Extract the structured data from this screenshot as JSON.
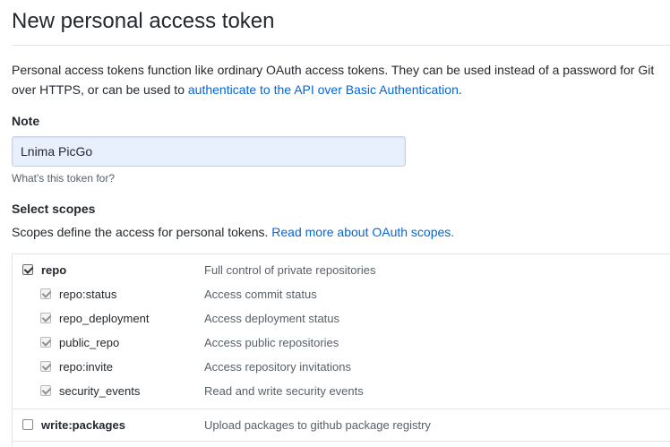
{
  "page": {
    "title": "New personal access token",
    "intro_text": "Personal access tokens function like ordinary OAuth access tokens. They can be used instead of a password for Git over HTTPS, or can be used to ",
    "intro_link": "authenticate to the API over Basic Authentication",
    "intro_end": "."
  },
  "note": {
    "label": "Note",
    "value": "Lnima PicGo",
    "hint": "What's this token for?"
  },
  "scopes": {
    "label": "Select scopes",
    "desc": "Scopes define the access for personal tokens. ",
    "link": "Read more about OAuth scopes.",
    "groups": [
      {
        "name": "repo",
        "desc": "Full control of private repositories",
        "checked": true,
        "children": [
          {
            "name": "repo:status",
            "desc": "Access commit status",
            "checked": true
          },
          {
            "name": "repo_deployment",
            "desc": "Access deployment status",
            "checked": true
          },
          {
            "name": "public_repo",
            "desc": "Access public repositories",
            "checked": true
          },
          {
            "name": "repo:invite",
            "desc": "Access repository invitations",
            "checked": true
          },
          {
            "name": "security_events",
            "desc": "Read and write security events",
            "checked": true
          }
        ]
      },
      {
        "name": "write:packages",
        "desc": "Upload packages to github package registry",
        "checked": false,
        "children": []
      }
    ]
  }
}
